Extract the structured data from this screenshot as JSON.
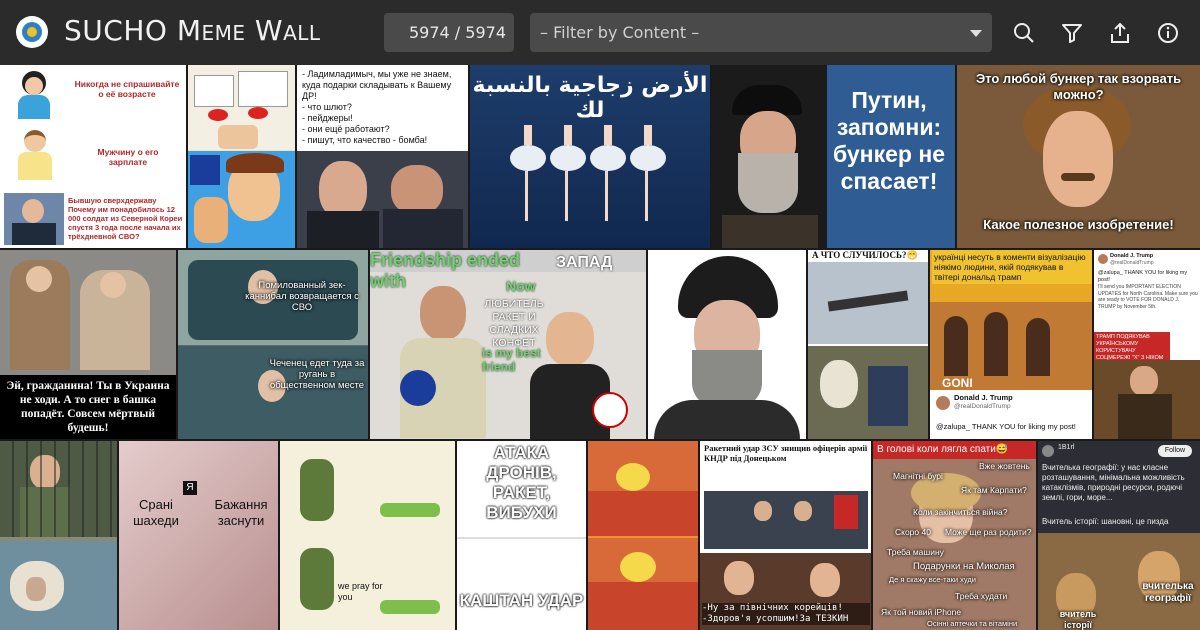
{
  "app": {
    "title_first": "SUCHO ",
    "title_rest": "Meme Wall",
    "count": "5974 / 5974",
    "filter_placeholder": "– Filter by Content –",
    "icons": [
      "search-icon",
      "filter-icon",
      "share-icon",
      "info-icon"
    ]
  },
  "tiles": {
    "t1": {
      "line1": "Никогда не спрашивайте о её возрасте",
      "line2": "Мужчину о его зарплате",
      "line3": "Бывшую сверхдержаву Почему им понадобилось 12 000 солдат из Северной Кореи спустя 3 года после начала их трёхдневной СВО?"
    },
    "t3": {
      "text": "- Ладимладимыч, мы уже не знаем, куда подарки складывать к Вашему ДР!\n- что шлют?\n- пейджеры!\n- они ещё работают?\n- пишут, что качество - бомба!"
    },
    "t4": {
      "text": "الأرض زجاجية بالنسبة لك"
    },
    "t5": {
      "text": "Путин, запомни: бункер не спасает!"
    },
    "t6": {
      "top": "Это любой бункер так взорвать можно?",
      "bottom": "Какое полезное изобретение!"
    },
    "t7": {
      "text": "Эй, гражданина! Ты в Украина не ходи. А то снег в башка попадёт. Совсем мёртвый будешь!"
    },
    "t8": {
      "top": "Помилованный зек-каннибал возвращается с СВО",
      "bottom": "Чеченец едет туда за ругань в общественном месте"
    },
    "t9": {
      "top": "Friendship ended with",
      "right": "ЗАПАД",
      "now": "Now",
      "fan": "ЛЮБИТЕЛЬ РАКЕТ И СЛАДКИХ КОНФЕТ",
      "is": "is my best friend"
    },
    "t11": {
      "text": "А ЧТО СЛУЧИЛОСЬ?😁"
    },
    "t12": {
      "text": "українці несуть в коменти візуалізацію ніякімо людини, якій подякував в твітері дональд трамп",
      "brand": "GONI",
      "tweet_name": "Donald J. Trump",
      "tweet_handle": "@realDonaldTrump",
      "tweet_text": "@zalupa_ THANK YOU for liking my post!"
    },
    "t13": {
      "name": "Donald J. Trump",
      "handle": "@realDonaldTrump",
      "text": "@zalupa_ THANK YOU for liking my post!",
      "text2": "I'll send you IMPORTANT ELECTION UPDATES for North Carolina. Make sure you are ready to VOTE FOR DONALD J. TRUMP by November 5th.",
      "banner": "ТРАМП ПОДЯКУВАВ УКРАЇНСЬКОМУ КОРИСТУВАЧУ СОЦМЕРЕЖІ \"Х\" З НІКОМ ZALUPA"
    },
    "t15": {
      "left": "Срані шахеди",
      "right": "Бажання заснути",
      "sign": "Я"
    },
    "t16": {
      "text": "we pray for you"
    },
    "t17": {
      "top": "АТАКА ДРОНІВ, РАКЕТ, ВИБУХИ",
      "bottom": "КАШТАН УДАР"
    },
    "t19": {
      "title": "Ракетний удар ЗСУ знищив офіцерів армії КНДР під Донецьком",
      "bottom": "-Ну за північних корейців! -Здоров'я усопшим!За ТЕЗКИН"
    },
    "t20": {
      "title": "В голові коли лягла спати😅",
      "words": [
        "Вже жовтень",
        "Магнітні бурі",
        "Як там Карпати?",
        "Коли закінчиться війна?",
        "Скоро 40",
        "Може ще раз родити?",
        "Треба машину",
        "Подарунки на Миколая",
        "Де я скажу все-таки худи",
        "Треба худати",
        "Як той новий iPhone",
        "Осінні аптечки та вітаміни"
      ]
    },
    "t21": {
      "user": "1B1rl",
      "follow": "Follow",
      "text": "Вчителька географії: у нас класне розташування, мінімальна можливість катаклізмів, природні ресурси, родючі землі, гори, море...",
      "text2": "Вчитель історії: шановні, це пиздa",
      "tag1": "вчителька географії",
      "tag2": "вчитель історії"
    }
  },
  "colors": {
    "topbar": "#2b2b2b",
    "field": "#4a4a4a",
    "accent_blue": "#2f7fc7"
  }
}
